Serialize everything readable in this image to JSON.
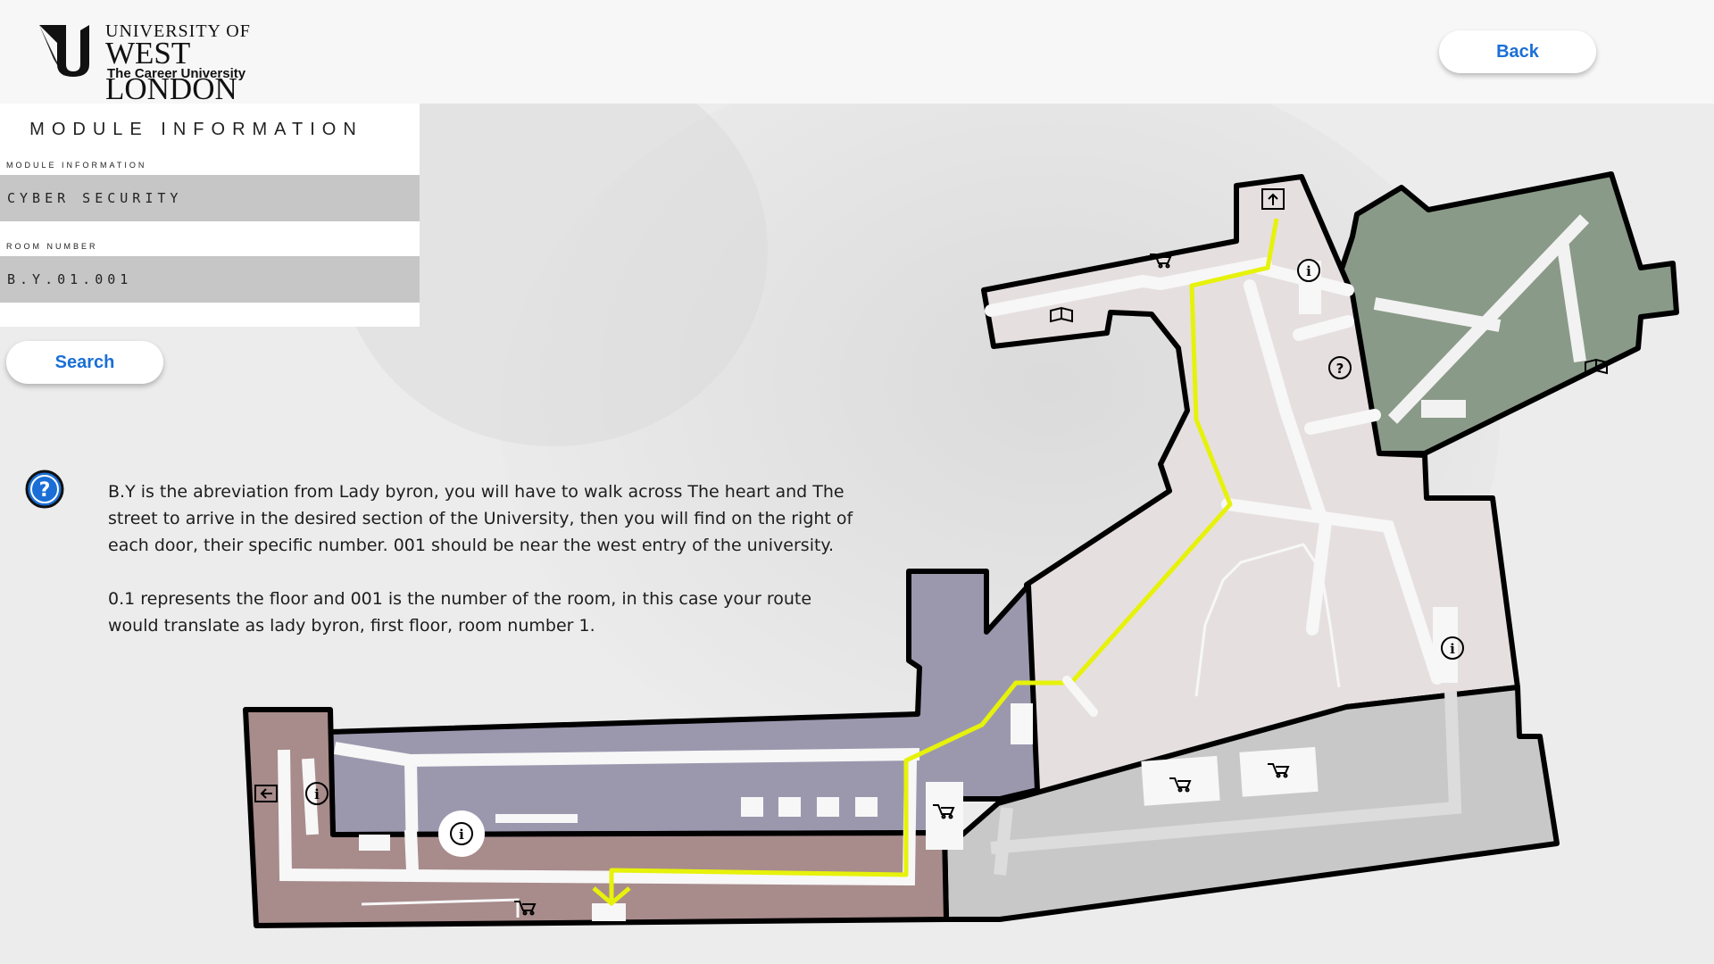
{
  "brand": {
    "line1": "UNIVERSITY OF",
    "line2": "WEST LONDON",
    "tagline": "The Career University"
  },
  "header": {
    "back_label": "Back"
  },
  "panel": {
    "title": "MODULE INFORMATION",
    "module_caption": "MODULE INFORMATION",
    "module_value": "CYBER SECURITY",
    "room_caption": "ROOM NUMBER",
    "room_value": "B.Y.01.001",
    "search_label": "Search"
  },
  "help": {
    "paragraph1": "B.Y is the abreviation from Lady byron, you will have to walk across The heart and The street to arrive in the desired section of the University, then you will find on the right of each door, their specific number. 001 should be near the west entry of the university.",
    "paragraph2": "0.1 represents the floor and 001 is the number of the room, in this case your route would translate as lady byron, first floor, room number 1."
  },
  "colors": {
    "accent": "#1a6fd6",
    "route": "#e6f20a",
    "zone_green": "#8a9a88",
    "zone_purple": "#9b98ae",
    "zone_brown": "#a88b8b",
    "zone_pink": "#e6dfe0",
    "zone_grey": "#c8c8c8"
  },
  "icons": [
    "info-icon",
    "help-icon",
    "cart-icon",
    "book-icon",
    "exit-icon",
    "arrow-down-icon"
  ]
}
